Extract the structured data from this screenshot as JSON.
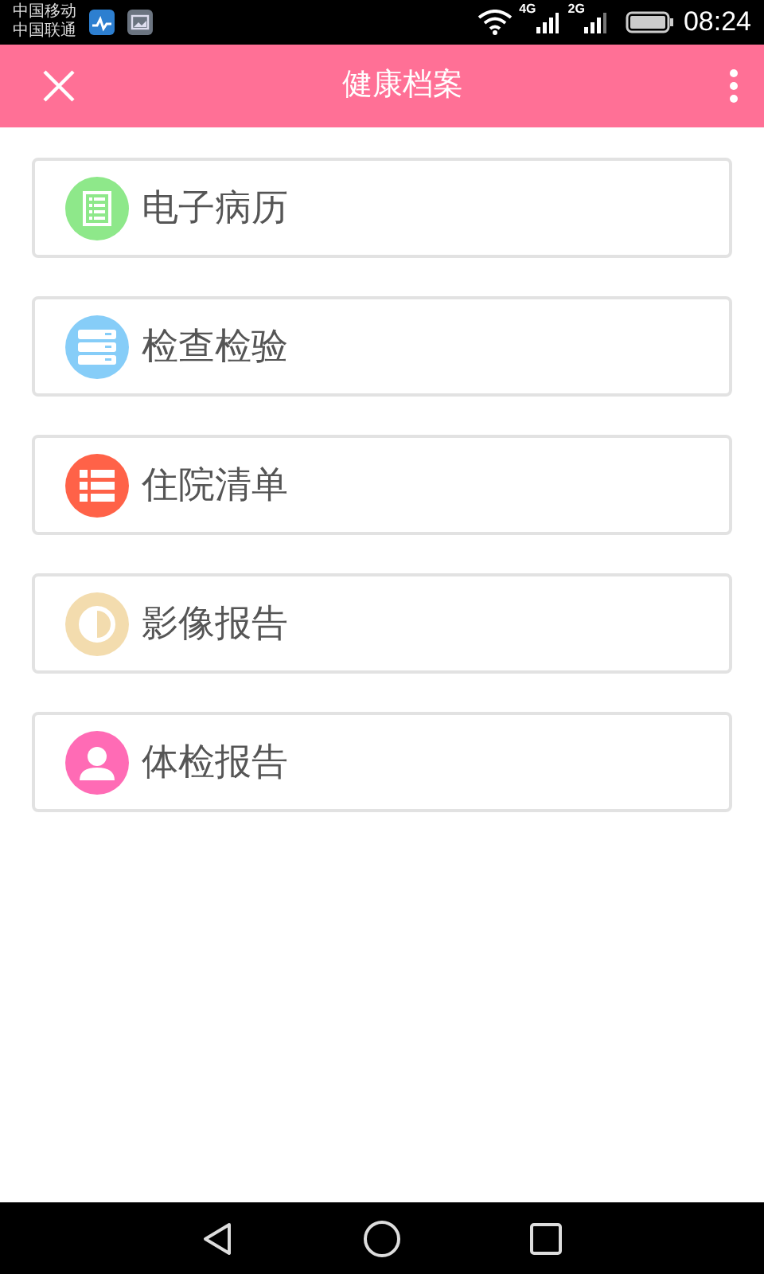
{
  "status_bar": {
    "carriers": [
      "中国移动",
      "中国联通"
    ],
    "network_1": "4G",
    "network_2": "2G",
    "time": "08:24"
  },
  "header": {
    "title": "健康档案"
  },
  "items": [
    {
      "label": "电子病历",
      "kind": "record",
      "color": "#8ee88a"
    },
    {
      "label": "检查检验",
      "kind": "stack",
      "color": "#86cdf8"
    },
    {
      "label": "住院清单",
      "kind": "list",
      "color": "#ff6248"
    },
    {
      "label": "影像报告",
      "kind": "contrast",
      "color": "#f3dcae"
    },
    {
      "label": "体检报告",
      "kind": "person",
      "color": "#ff6bb5"
    }
  ]
}
